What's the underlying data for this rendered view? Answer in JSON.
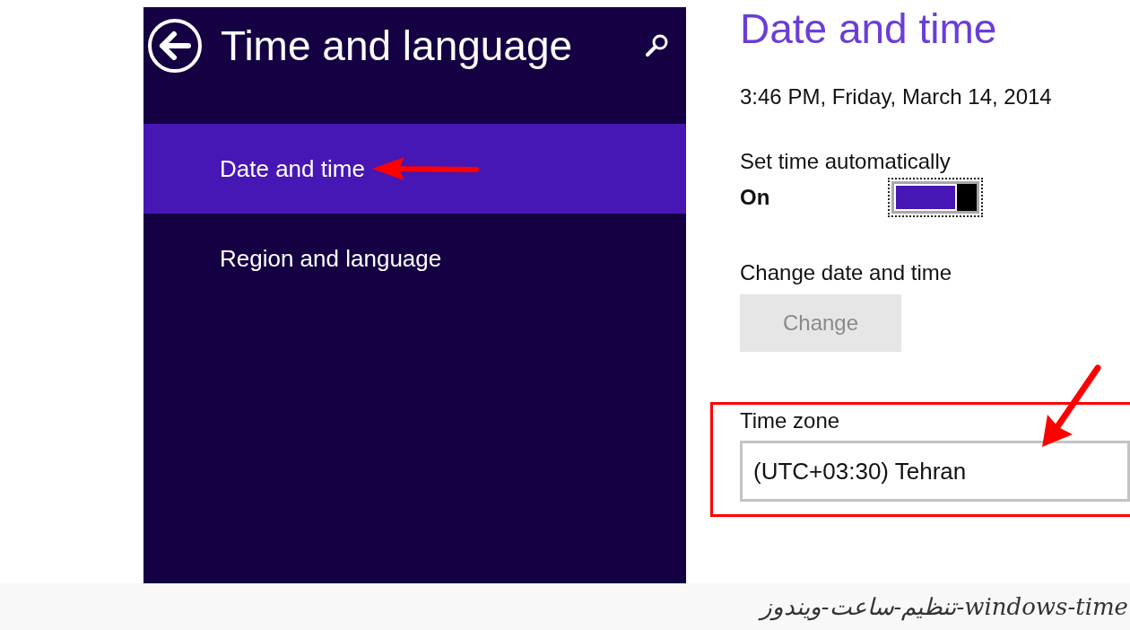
{
  "sidebar": {
    "title": "Time and language",
    "items": [
      {
        "label": "Date and time",
        "selected": true
      },
      {
        "label": "Region and language",
        "selected": false
      }
    ]
  },
  "content": {
    "title": "Date and time",
    "current_time": "3:46 PM, Friday, March 14, 2014",
    "auto_time": {
      "label": "Set time automatically",
      "state_text": "On",
      "on": true
    },
    "change": {
      "label": "Change date and time",
      "button": "Change",
      "disabled": true
    },
    "time_zone": {
      "label": "Time zone",
      "value": "(UTC+03:30) Tehran"
    }
  },
  "caption": "windows-time-تنظیم-ساعت-ویندوز"
}
